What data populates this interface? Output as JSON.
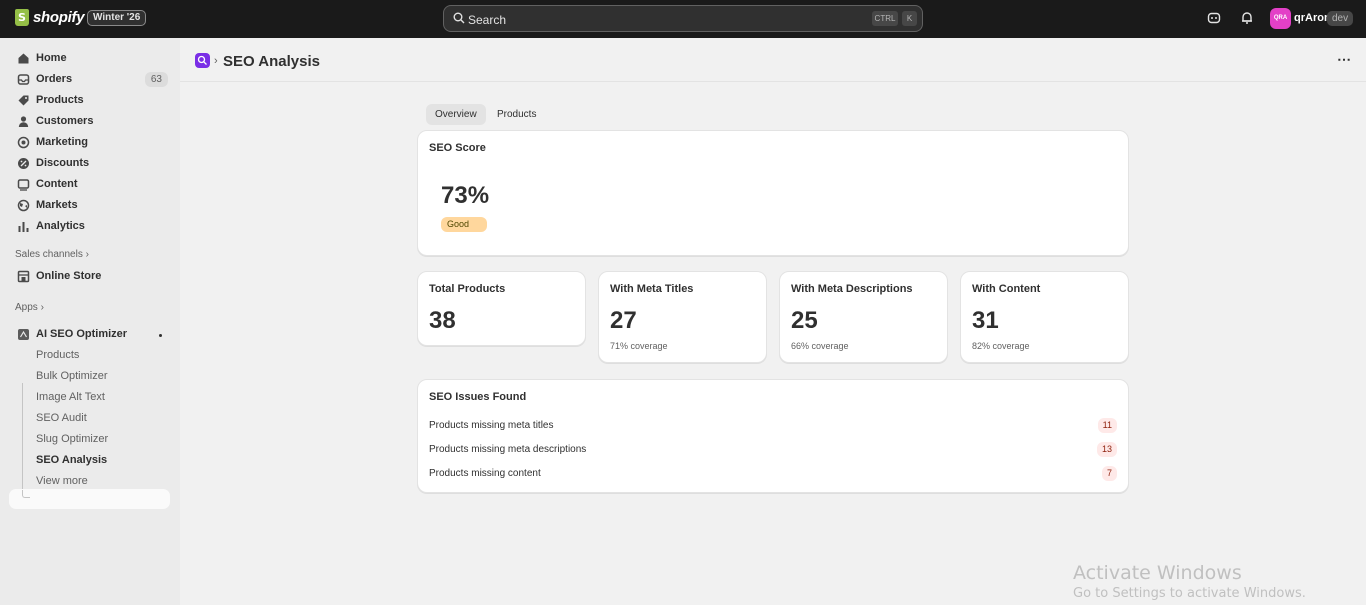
{
  "topbar": {
    "brand": "shopify",
    "version_badge": "Winter '26",
    "search_label": "Search",
    "shortcut_1": "CTRL",
    "shortcut_2": "K",
    "avatar_initials": "QRA",
    "username": "qrAron",
    "dev_badge": "dev"
  },
  "sidebar": {
    "items": [
      {
        "label": "Home",
        "icon": "home-icon"
      },
      {
        "label": "Orders",
        "icon": "inbox-icon",
        "count": "63"
      },
      {
        "label": "Products",
        "icon": "tag-icon"
      },
      {
        "label": "Customers",
        "icon": "person-icon"
      },
      {
        "label": "Marketing",
        "icon": "target-icon"
      },
      {
        "label": "Discounts",
        "icon": "discount-icon"
      },
      {
        "label": "Content",
        "icon": "image-icon"
      },
      {
        "label": "Markets",
        "icon": "globe-icon"
      },
      {
        "label": "Analytics",
        "icon": "bar-chart-icon"
      }
    ],
    "sales_channels_title": "Sales channels",
    "online_store": "Online Store",
    "apps_title": "Apps",
    "app_name": "AI SEO Optimizer",
    "app_subitems": [
      "Products",
      "Bulk Optimizer",
      "Image Alt Text",
      "SEO Audit",
      "Slug Optimizer",
      "SEO Analysis"
    ],
    "view_more": "View more"
  },
  "page": {
    "title": "SEO Analysis",
    "more_button": "⋯",
    "tabs": [
      "Overview",
      "Products"
    ]
  },
  "seo_score": {
    "title": "SEO Score",
    "value": "73%",
    "badge": "Good"
  },
  "stats": [
    {
      "title": "Total Products",
      "value": "38",
      "coverage": ""
    },
    {
      "title": "With Meta Titles",
      "value": "27",
      "coverage": "71% coverage"
    },
    {
      "title": "With Meta Descriptions",
      "value": "25",
      "coverage": "66% coverage"
    },
    {
      "title": "With Content",
      "value": "31",
      "coverage": "82% coverage"
    }
  ],
  "issues": {
    "title": "SEO Issues Found",
    "rows": [
      {
        "label": "Products missing meta titles",
        "count": "11"
      },
      {
        "label": "Products missing meta descriptions",
        "count": "13"
      },
      {
        "label": "Products missing content",
        "count": "7"
      }
    ]
  },
  "watermark": {
    "line1": "Activate Windows",
    "line2": "Go to Settings to activate Windows."
  },
  "colors": {
    "topbar": "#1a1a1a",
    "sidebar": "#ebebeb",
    "good_badge": "#ffd79d",
    "issue_badge": "#fee9e8",
    "app_icon": "#7a2ee6",
    "avatar": "#e340c7"
  }
}
